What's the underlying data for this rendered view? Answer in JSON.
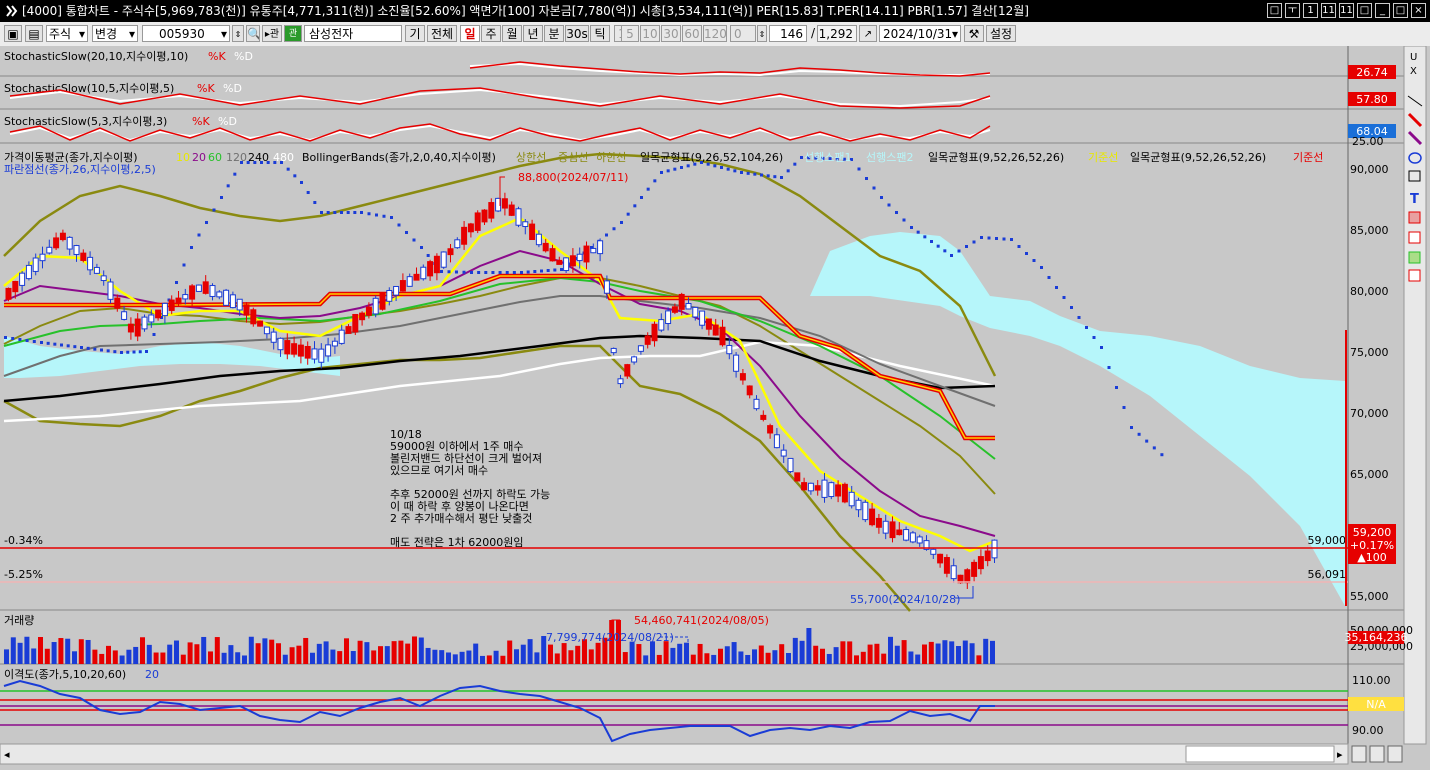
{
  "window": {
    "title": "[4000] 통합차트 - 주식수[5,969,783(천)] 유통주[4,771,311(천)] 소진율[52.60%] 액면가[100] 자본금[7,780(억)] 시총[3,534,111(억)] PER[15.83] T.PER[14.11] PBR[1.57] 결산[12월]",
    "buttons": [
      "□",
      "ㅜ",
      "1",
      "11",
      "11",
      "□",
      "_",
      "□",
      "×"
    ]
  },
  "toolbar": {
    "market": "주식",
    "change": "변경",
    "code": "005930",
    "name": "삼성전자",
    "btn_gi": "기",
    "btn_all": "전체",
    "periods": [
      "일",
      "주",
      "월",
      "년",
      "분",
      "30s",
      "틱"
    ],
    "intervals": [
      "1",
      "5",
      "10",
      "30",
      "60",
      "120"
    ],
    "spin_value": "0",
    "count": "146",
    "total": "1,292",
    "date": "2024/10/31",
    "settings": "설정"
  },
  "panels": {
    "stoch1": {
      "label": "StochasticSlow(20,10,지수이평,10)",
      "k": "%K",
      "d": "%D",
      "value": "26.74",
      "tick": ""
    },
    "stoch2": {
      "label": "StochasticSlow(10,5,지수이평,5)",
      "k": "%K",
      "d": "%D",
      "value": "57.80",
      "tick": "25.00"
    },
    "stoch3": {
      "label": "StochasticSlow(5,3,지수이평,3)",
      "k": "%K",
      "d": "%D",
      "value": "68.04",
      "tick": "25.00"
    },
    "main": {
      "legend_ma": "가격이동평균(종가,지수이평)",
      "ma_periods": [
        "10",
        "20",
        "60",
        "120",
        "240",
        "480"
      ],
      "legend_bb": "BollingerBands(종가,2,0,40,지수이평)",
      "bb_lines": [
        "상한선",
        "중심선",
        "하한선"
      ],
      "legend_ichi1": "일목균형표(9,26,52,104,26)",
      "ichi1_lines": [
        "선행스팬1",
        "선행스팬2"
      ],
      "legend_ichi2": "일목균형표(9,52,26,52,26)",
      "ichi2_line": "기준선",
      "legend_ichi3": "일목균형표(9,52,26,52,26)",
      "ichi3_line": "기준선",
      "legend_sar": "파란점선(종가,26,지수이평,2,5)",
      "high_label": "88,800(2024/07/11)",
      "low_label": "55,700(2024/10/28)",
      "pct1": "-0.34%",
      "pct2": "-5.25%",
      "line1_value": "59,000",
      "line2_value": "56,091",
      "price_box": [
        "59,200",
        "+0.17%",
        "▲100"
      ],
      "yticks": [
        "90,000",
        "85,000",
        "80,000",
        "75,000",
        "70,000",
        "65,000",
        "55,000"
      ],
      "memo": [
        "10/18",
        "59000원 이하에서 1주 매수",
        "볼린저밴드 하단선이 크게 벌어져",
        "있으므로 여기서 매수",
        "",
        "추후 52000원 선까지 하락도 가능",
        "이 때 하락 후 양봉이 나온다면",
        "2 주 추가매수해서 평단 낮출것",
        "",
        "매도 전략은 1차 62000원임"
      ]
    },
    "volume": {
      "label": "거래량",
      "max_label": "54,460,741(2024/08/05)",
      "min_label": "7,799,774(2024/08/21)",
      "yticks": [
        "50,000,000",
        "25,000,000"
      ],
      "value": "35,164,236"
    },
    "disparity": {
      "label": "이격도(종가,5,10,20,60)",
      "label2": "20",
      "yticks": [
        "110.00",
        "90.00"
      ],
      "value": "N/A"
    }
  },
  "colors": {
    "up": "#e60000",
    "down": "#1a3cd6",
    "cloud": "#b6f6fa",
    "bg": "#c8c8c8"
  }
}
